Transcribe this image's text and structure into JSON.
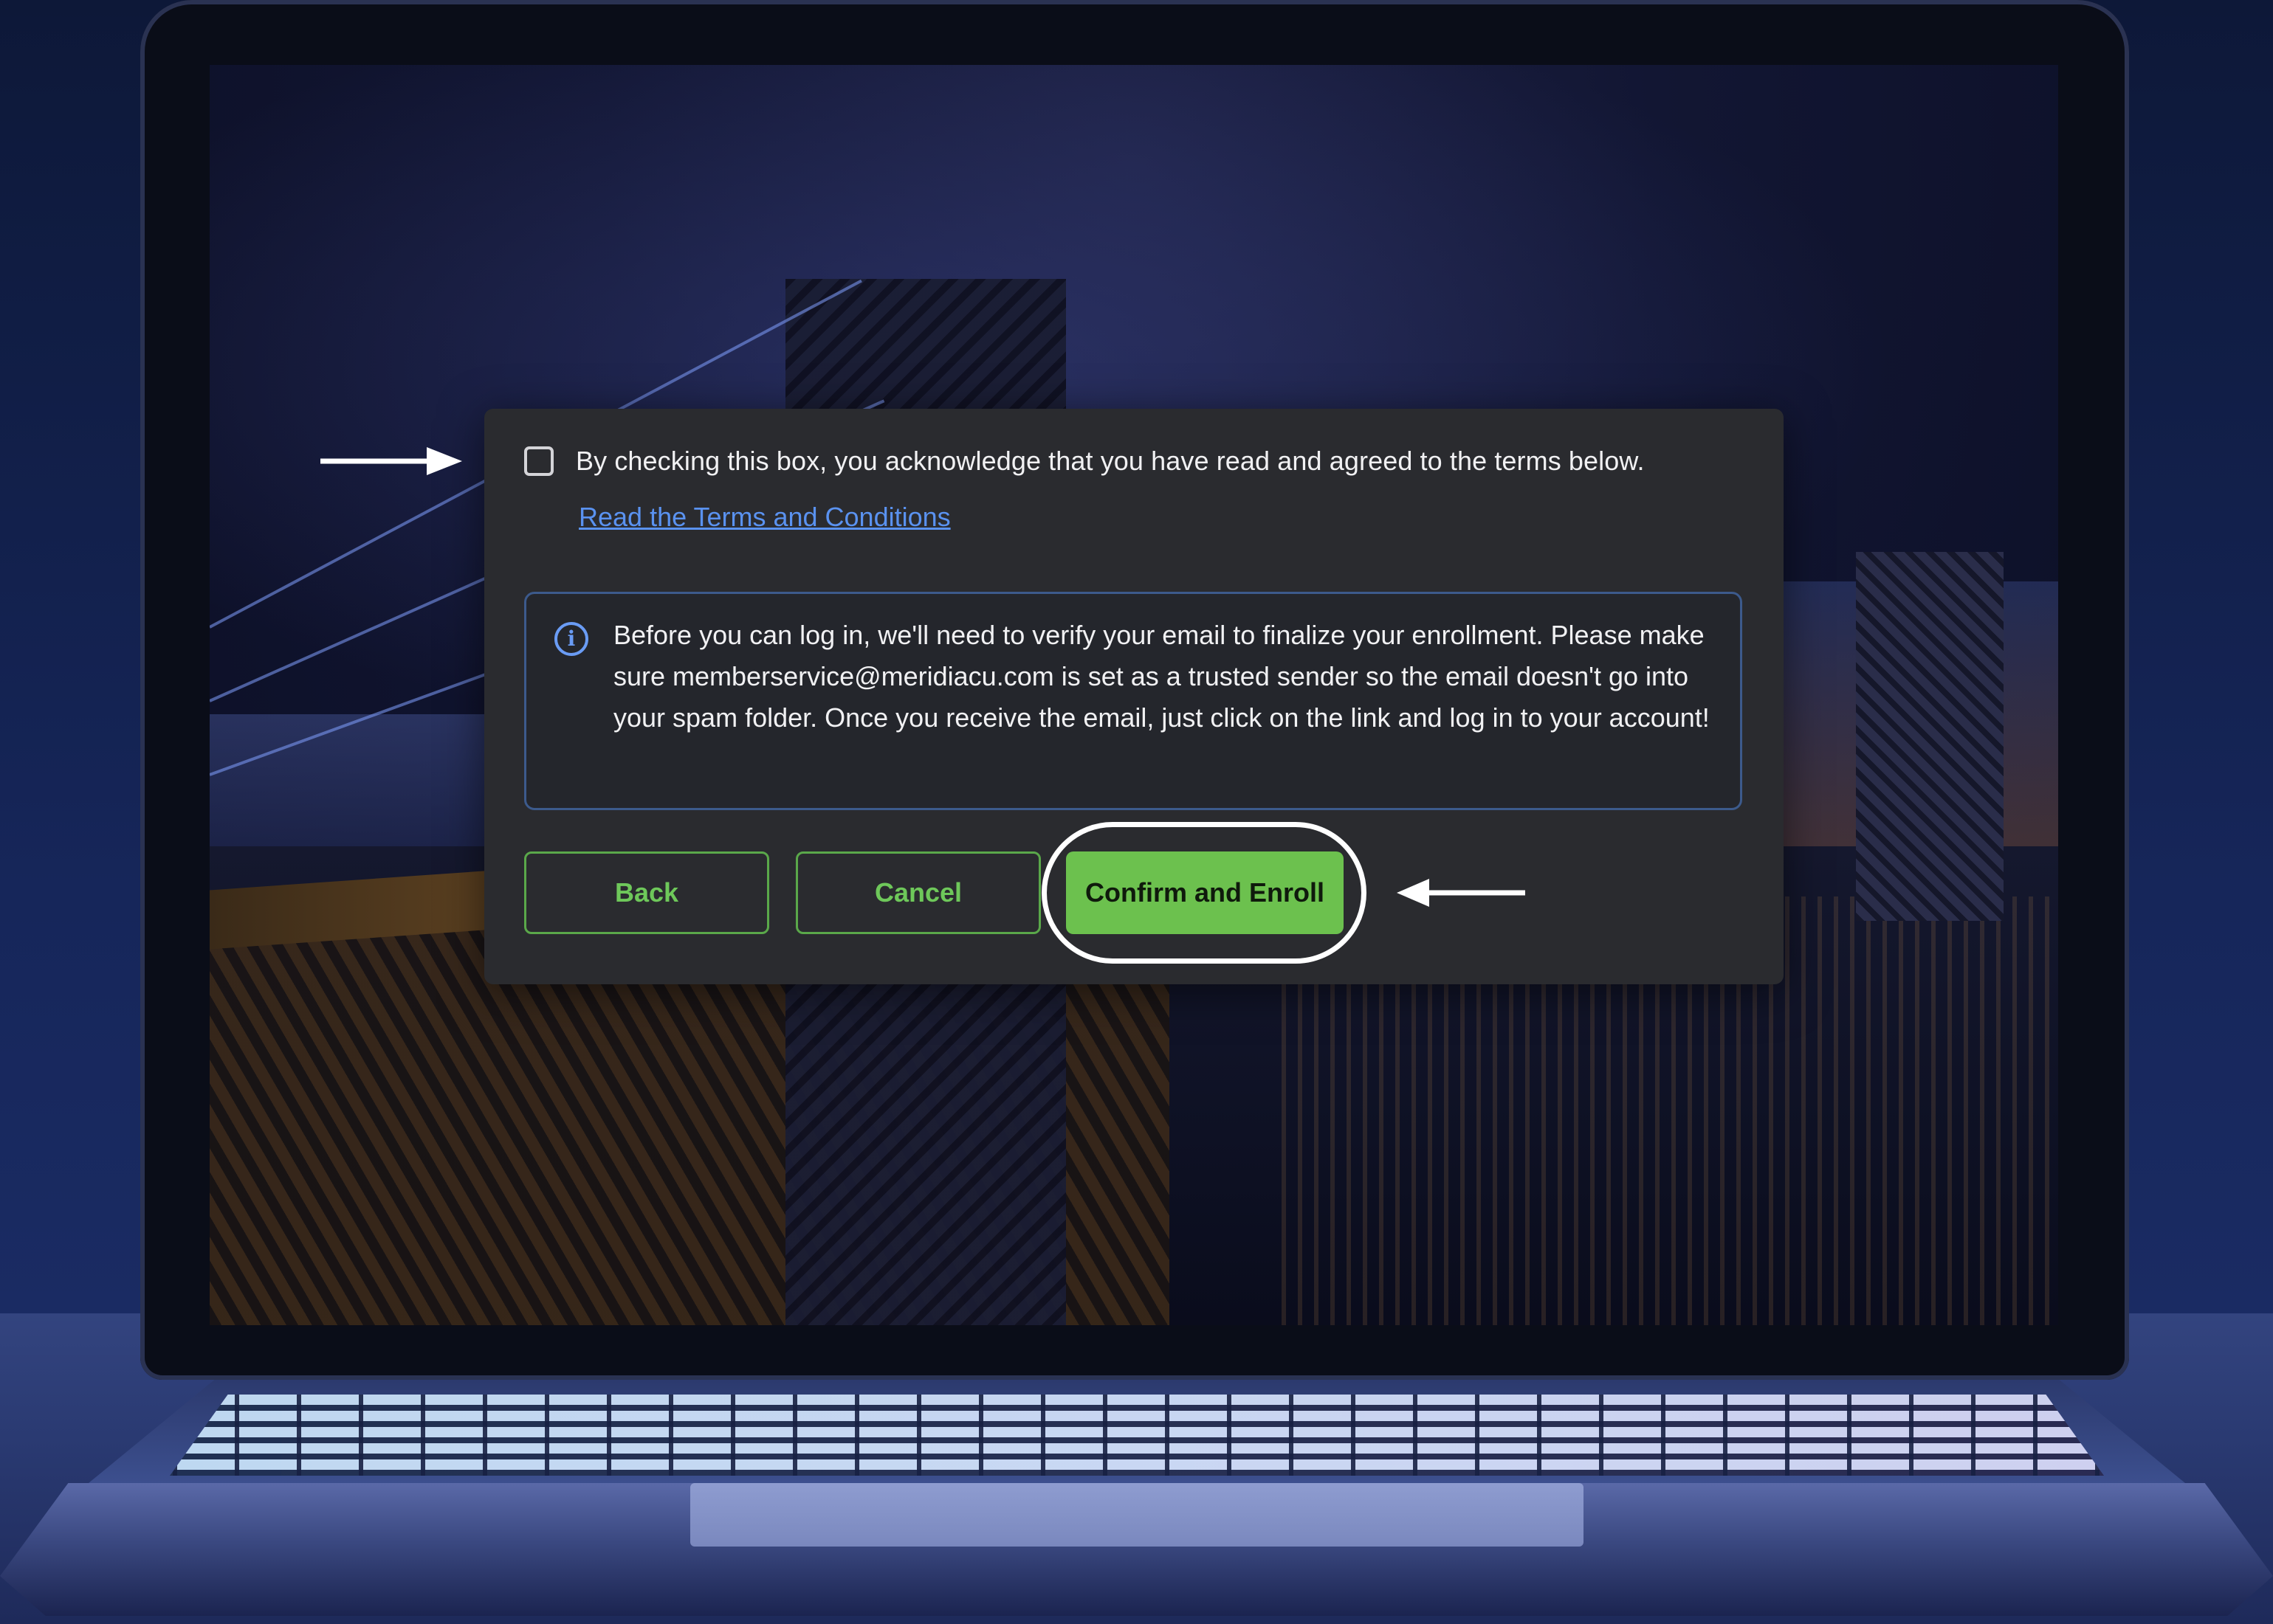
{
  "dialog": {
    "terms": {
      "checkbox_checked": false,
      "acknowledgement": "By checking this box, you acknowledge that you have read and agreed to the terms below.",
      "link_label": "Read the Terms and Conditions"
    },
    "info": {
      "icon": "info-circle-icon",
      "message": "Before you can log in, we'll need to verify your email to finalize your enrollment. Please make sure memberservice@meridiacu.com is set as a trusted sender so the email doesn't go into your spam folder. Once you receive the email, just click on the link and log in to your account!"
    },
    "buttons": {
      "back_label": "Back",
      "cancel_label": "Cancel",
      "confirm_label": "Confirm and Enroll"
    }
  },
  "colors": {
    "dialog_bg": "#2a2b2f",
    "accent_green": "#6cc14e",
    "link_blue": "#5a92f0",
    "info_border": "#3c5a8c"
  },
  "annotations": {
    "arrow_to_checkbox": "arrow-right-icon",
    "arrow_to_confirm": "arrow-left-icon",
    "highlight": "confirm-button-highlight-ring"
  }
}
